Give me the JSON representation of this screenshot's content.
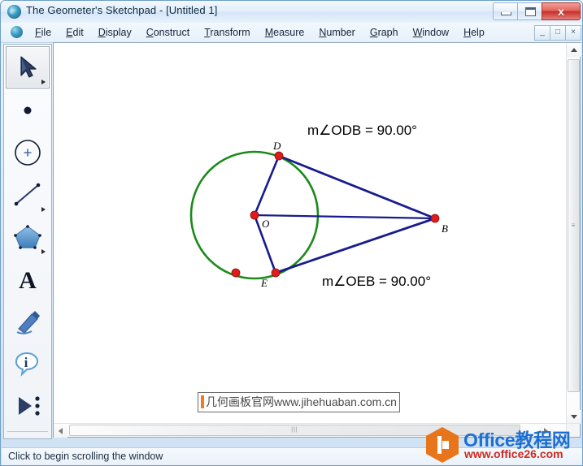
{
  "window": {
    "title": "The Geometer's Sketchpad - [Untitled 1]",
    "app_icon": "sketchpad-globe-icon",
    "controls": {
      "minimize": "–",
      "maximize": "□",
      "close": "x"
    }
  },
  "menubar": {
    "icon": "sketchpad-globe-icon",
    "items": [
      {
        "label": "File",
        "accel": "F"
      },
      {
        "label": "Edit",
        "accel": "E"
      },
      {
        "label": "Display",
        "accel": "D"
      },
      {
        "label": "Construct",
        "accel": "C"
      },
      {
        "label": "Transform",
        "accel": "T"
      },
      {
        "label": "Measure",
        "accel": "M"
      },
      {
        "label": "Number",
        "accel": "N"
      },
      {
        "label": "Graph",
        "accel": "G"
      },
      {
        "label": "Window",
        "accel": "W"
      },
      {
        "label": "Help",
        "accel": "H"
      }
    ],
    "mdi_controls": {
      "minimize": "_",
      "restore": "□",
      "close": "×"
    }
  },
  "toolbar": {
    "tools": [
      {
        "name": "arrow-select-tool",
        "icon": "arrow-cursor-icon",
        "selected": true,
        "has_flyout": true
      },
      {
        "name": "point-tool",
        "icon": "point-dot-icon",
        "selected": false,
        "has_flyout": false
      },
      {
        "name": "compass-circle-tool",
        "icon": "circle-compass-icon",
        "selected": false,
        "has_flyout": false
      },
      {
        "name": "straightedge-tool",
        "icon": "line-segment-icon",
        "selected": false,
        "has_flyout": true
      },
      {
        "name": "polygon-tool",
        "icon": "pentagon-icon",
        "selected": false,
        "has_flyout": true
      },
      {
        "name": "text-tool",
        "icon": "letter-a-icon",
        "selected": false,
        "has_flyout": false
      },
      {
        "name": "marker-tool",
        "icon": "pen-marker-icon",
        "selected": false,
        "has_flyout": false
      },
      {
        "name": "information-tool",
        "icon": "info-bubble-icon",
        "selected": false,
        "has_flyout": false
      },
      {
        "name": "custom-tool",
        "icon": "play-triangle-dots-icon",
        "selected": false,
        "has_flyout": false
      }
    ]
  },
  "canvas": {
    "measurements": [
      {
        "name": "angle-odb-measurement",
        "text": "m∠ODB = 90.00°",
        "prefix": "m",
        "angle": "∠ODB",
        "value": "90.00°"
      },
      {
        "name": "angle-oeb-measurement",
        "text": "m∠OEB = 90.00°",
        "prefix": "m",
        "angle": "∠OEB",
        "value": "90.00°"
      }
    ],
    "point_labels": {
      "center": "O",
      "top": "D",
      "bottom": "E",
      "external": "B"
    },
    "colors": {
      "circle": "#1a8a1a",
      "segment": "#181c8c",
      "point": "#e01b1b"
    },
    "watermark_box": {
      "text": "几何画板官网www.jihehuaban.com.cn",
      "caret_color": "#f07d1b"
    }
  },
  "scrollbars": {
    "vertical": {
      "up": "▲",
      "down": "▼",
      "grip": "≡"
    },
    "horizontal": {
      "left": "◄",
      "right": "►",
      "grip": "‖"
    }
  },
  "statusbar": {
    "text": "Click to begin scrolling the window"
  },
  "page_watermark": {
    "title": "Office教程网",
    "url": "www.office26.com",
    "logo_color": "#e8751a",
    "title_color": "#1f6fd0",
    "url_color": "#cf2a20"
  }
}
